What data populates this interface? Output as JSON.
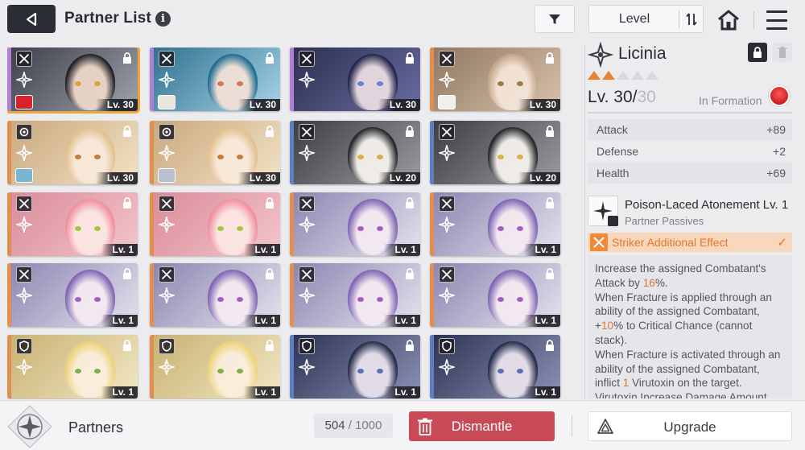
{
  "header": {
    "title": "Partner List",
    "info_icon": "i",
    "sort_label": "Level"
  },
  "icons": {
    "back": "back-arrow-icon",
    "filter": "filter-icon",
    "sort_order": "sort-order-icon",
    "home": "home-icon",
    "menu": "menu-icon"
  },
  "partners": [
    {
      "level": "Lv. 30",
      "type": "swords",
      "stripe": "#b07fd8",
      "bg1": "#3a3d48",
      "bg2": "#9ea3ad",
      "face": "#ecd6c8",
      "hair": "#1e1f26",
      "eye": "#e0a33a",
      "assigned": "#d92128",
      "selected": true
    },
    {
      "level": "Lv. 30",
      "type": "swords",
      "stripe": "#b07fd8",
      "bg1": "#2d6f8e",
      "bg2": "#a7d4e6",
      "face": "#f1e0d6",
      "hair": "#1d6b93",
      "eye": "#d27a4f",
      "assigned": "#e9e6e0",
      "selected": false
    },
    {
      "level": "Lv. 30",
      "type": "swords",
      "stripe": "#b07fd8",
      "bg1": "#2b2e4c",
      "bg2": "#6a6da3",
      "face": "#e9dbe0",
      "hair": "#22244a",
      "eye": "#6b7fd6",
      "assigned": null,
      "selected": false
    },
    {
      "level": "Lv. 30",
      "type": "swords",
      "stripe": "#e08f4e",
      "bg1": "#8f7762",
      "bg2": "#d8c2ac",
      "face": "#f4e4d8",
      "hair": "#c5a88b",
      "eye": "#9d7a4a",
      "assigned": "#f1eeec",
      "selected": false
    },
    {
      "level": "Lv. 30",
      "type": "gear",
      "stripe": "#e08f4e",
      "bg1": "#c9a77c",
      "bg2": "#f2e3c7",
      "face": "#f8e9da",
      "hair": "#e3bf8c",
      "eye": "#c57c3c",
      "assigned": "#79b6cf",
      "selected": false
    },
    {
      "level": "Lv. 30",
      "type": "gear",
      "stripe": "#e08f4e",
      "bg1": "#c9a77c",
      "bg2": "#f2e3c7",
      "face": "#f8e9da",
      "hair": "#e3bf8c",
      "eye": "#c57c3c",
      "assigned": "#b9bfd0",
      "selected": false
    },
    {
      "level": "Lv. 20",
      "type": "swords",
      "stripe": "#5f7ec4",
      "bg1": "#3b3b40",
      "bg2": "#9b9ba1",
      "face": "#f5f1ec",
      "hair": "#262629",
      "eye": "#d8b14a",
      "assigned": null,
      "selected": false
    },
    {
      "level": "Lv. 20",
      "type": "swords",
      "stripe": "#5f7ec4",
      "bg1": "#3b3b40",
      "bg2": "#9b9ba1",
      "face": "#f5f1ec",
      "hair": "#262629",
      "eye": "#d8b14a",
      "assigned": null,
      "selected": false
    },
    {
      "level": "Lv. 1",
      "type": "swords",
      "stripe": "#e08f4e",
      "bg1": "#d98a97",
      "bg2": "#f4c6cd",
      "face": "#fbe6e2",
      "hair": "#f08fa0",
      "eye": "#a8c441",
      "assigned": null,
      "selected": false
    },
    {
      "level": "Lv. 1",
      "type": "swords",
      "stripe": "#e08f4e",
      "bg1": "#d98a97",
      "bg2": "#f4c6cd",
      "face": "#fbe6e2",
      "hair": "#f08fa0",
      "eye": "#a8c441",
      "assigned": null,
      "selected": false
    },
    {
      "level": "Lv. 1",
      "type": "swords",
      "stripe": "#e08f4e",
      "bg1": "#8a84b0",
      "bg2": "#e5e3ee",
      "face": "#f4eaf0",
      "hair": "#7e64b3",
      "eye": "#a25fc7",
      "assigned": null,
      "selected": false
    },
    {
      "level": "Lv. 1",
      "type": "swords",
      "stripe": "#e08f4e",
      "bg1": "#8a84b0",
      "bg2": "#e5e3ee",
      "face": "#f4eaf0",
      "hair": "#7e64b3",
      "eye": "#a25fc7",
      "assigned": null,
      "selected": false
    },
    {
      "level": "Lv. 1",
      "type": "swords",
      "stripe": "#e08f4e",
      "bg1": "#8a84b0",
      "bg2": "#e5e3ee",
      "face": "#f4eaf0",
      "hair": "#7e64b3",
      "eye": "#a25fc7",
      "assigned": null,
      "selected": false
    },
    {
      "level": "Lv. 1",
      "type": "swords",
      "stripe": "#e08f4e",
      "bg1": "#8a84b0",
      "bg2": "#e5e3ee",
      "face": "#f4eaf0",
      "hair": "#7e64b3",
      "eye": "#a25fc7",
      "assigned": null,
      "selected": false
    },
    {
      "level": "Lv. 1",
      "type": "swords",
      "stripe": "#e08f4e",
      "bg1": "#8a84b0",
      "bg2": "#e5e3ee",
      "face": "#f4eaf0",
      "hair": "#7e64b3",
      "eye": "#a25fc7",
      "assigned": null,
      "selected": false
    },
    {
      "level": "Lv. 1",
      "type": "swords",
      "stripe": "#e08f4e",
      "bg1": "#8a84b0",
      "bg2": "#e5e3ee",
      "face": "#f4eaf0",
      "hair": "#7e64b3",
      "eye": "#a25fc7",
      "assigned": null,
      "selected": false
    },
    {
      "level": "Lv. 1",
      "type": "shield",
      "stripe": "#e08f4e",
      "bg1": "#c8b070",
      "bg2": "#f1e8c6",
      "face": "#fbeedd",
      "hair": "#ecd479",
      "eye": "#7fb04c",
      "assigned": null,
      "selected": false
    },
    {
      "level": "Lv. 1",
      "type": "shield",
      "stripe": "#e08f4e",
      "bg1": "#c8b070",
      "bg2": "#f1e8c6",
      "face": "#fbeedd",
      "hair": "#ecd479",
      "eye": "#7fb04c",
      "assigned": null,
      "selected": false
    },
    {
      "level": "Lv. 1",
      "type": "shield",
      "stripe": "#5f7ec4",
      "bg1": "#2b3250",
      "bg2": "#8b92b6",
      "face": "#e7e1ec",
      "hair": "#252b4a",
      "eye": "#5b6fb8",
      "assigned": null,
      "selected": false
    },
    {
      "level": "Lv. 1",
      "type": "shield",
      "stripe": "#5f7ec4",
      "bg1": "#2b3250",
      "bg2": "#8b92b6",
      "face": "#e7e1ec",
      "hair": "#252b4a",
      "eye": "#5b6fb8",
      "assigned": null,
      "selected": false
    }
  ],
  "detail": {
    "name": "Licinia",
    "stars_on": 2,
    "stars_total": 5,
    "level_current": "Lv. 30/",
    "level_max": "30",
    "in_formation": "In Formation",
    "stats": [
      {
        "label": "Attack",
        "value": "+89"
      },
      {
        "label": "Defense",
        "value": "+2"
      },
      {
        "label": "Health",
        "value": "+69"
      }
    ],
    "skill_name": "Poison-Laced Atonement Lv. 1",
    "skill_category": "Partner Passives",
    "striker_label": "Striker Additional Effect",
    "description": [
      {
        "t": "Increase the assigned Combatant's Attack by "
      },
      {
        "t": "16",
        "hl": true
      },
      {
        "t": "%.\nWhen Fracture is applied through an ability of the assigned Combatant, +"
      },
      {
        "t": "10",
        "hl": true
      },
      {
        "t": "% to Critical Chance (cannot stack).\nWhen Fracture is activated through an ability of the assigned Combatant, inflict "
      },
      {
        "t": "1",
        "hl": true
      },
      {
        "t": " Virutoxin on the target.\nVirutoxin Increase Damage Amount"
      }
    ]
  },
  "footer": {
    "partners_label": "Partners",
    "count_current": "504",
    "count_sep": " / ",
    "count_max": "1000",
    "dismantle_label": "Dismantle",
    "upgrade_label": "Upgrade"
  },
  "colors": {
    "accent_orange": "#e3762a",
    "dismantle_red": "#c84a57",
    "dark": "#2b2d35",
    "selection": "#f0a53a"
  }
}
